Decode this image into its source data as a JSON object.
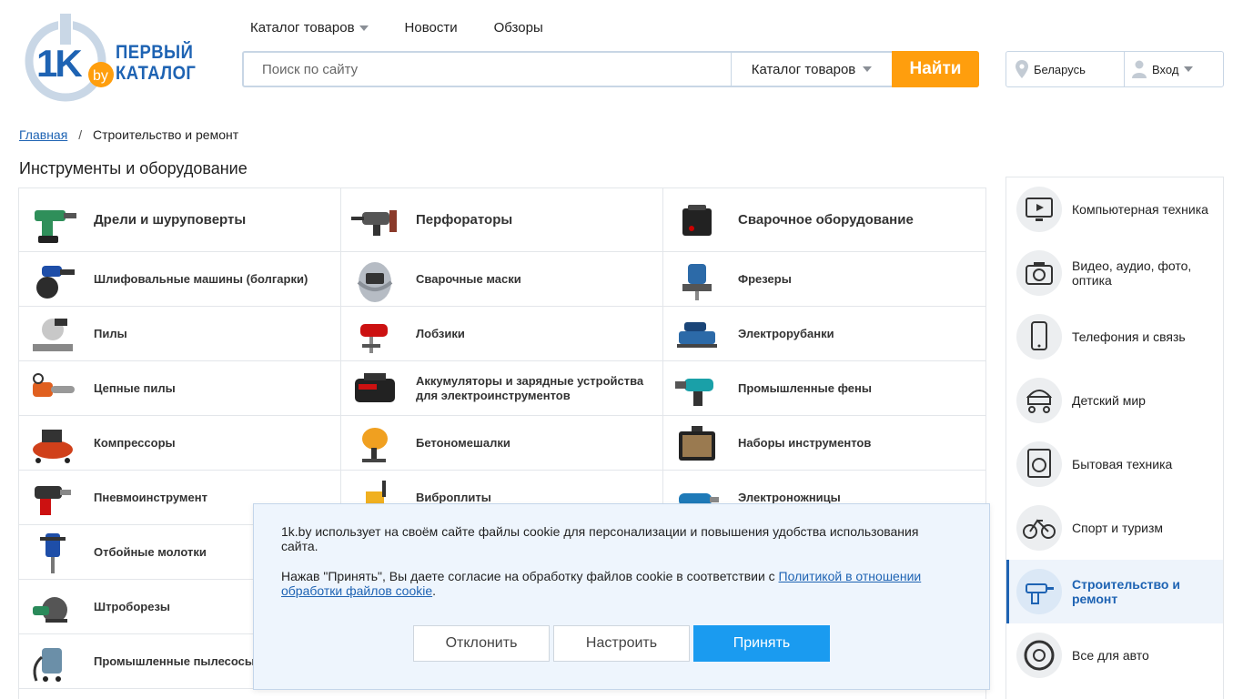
{
  "brand": {
    "logo_mark": "1K",
    "logo_domain": "by",
    "name_line1": "ПЕРВЫЙ",
    "name_line2": "КАТАЛОГ",
    "color": "#1e63b3",
    "accent": "#ff9e0d"
  },
  "topnav": {
    "catalog": "Каталог товаров",
    "news": "Новости",
    "reviews": "Обзоры"
  },
  "search": {
    "placeholder": "Поиск по сайту",
    "scope": "Каталог товаров",
    "button": "Найти"
  },
  "region": {
    "country": "Беларусь",
    "login": "Вход"
  },
  "breadcrumb": {
    "home": "Главная",
    "separator": "/",
    "current": "Строительство и ремонт"
  },
  "page_title": "Инструменты и оборудование",
  "categories": [
    {
      "label": "Дрели и шуруповерты",
      "icon": "drill-icon"
    },
    {
      "label": "Перфораторы",
      "icon": "hammer-drill-icon"
    },
    {
      "label": "Сварочное оборудование",
      "icon": "welder-icon"
    },
    {
      "label": "Шлифовальные машины (болгарки)",
      "icon": "grinder-icon"
    },
    {
      "label": "Сварочные маски",
      "icon": "welding-mask-icon"
    },
    {
      "label": "Фрезеры",
      "icon": "router-icon"
    },
    {
      "label": "Пилы",
      "icon": "miter-saw-icon"
    },
    {
      "label": "Лобзики",
      "icon": "jigsaw-icon"
    },
    {
      "label": "Электрорубанки",
      "icon": "planer-icon"
    },
    {
      "label": "Цепные пилы",
      "icon": "chainsaw-icon"
    },
    {
      "label": "Аккумуляторы и зарядные устройства для электроинструментов",
      "icon": "battery-icon"
    },
    {
      "label": "Промышленные фены",
      "icon": "heat-gun-icon"
    },
    {
      "label": "Компрессоры",
      "icon": "compressor-icon"
    },
    {
      "label": "Бетономешалки",
      "icon": "concrete-mixer-icon"
    },
    {
      "label": "Наборы инструментов",
      "icon": "toolbox-icon"
    },
    {
      "label": "Пневмоинструмент",
      "icon": "impact-wrench-icon"
    },
    {
      "label": "Виброплиты",
      "icon": "plate-compactor-icon"
    },
    {
      "label": "Электроножницы",
      "icon": "shears-icon"
    },
    {
      "label": "Отбойные молотки",
      "icon": "demolition-hammer-icon"
    },
    {
      "label": "",
      "icon": ""
    },
    {
      "label": "",
      "icon": ""
    },
    {
      "label": "Штроборезы",
      "icon": "wall-chaser-icon"
    },
    {
      "label": "",
      "icon": ""
    },
    {
      "label": "",
      "icon": ""
    },
    {
      "label": "Промышленные пылесосы",
      "icon": "vacuum-icon"
    },
    {
      "label": "",
      "icon": ""
    },
    {
      "label": "",
      "icon": ""
    }
  ],
  "sidebar": [
    {
      "label": "Компьютерная техника",
      "icon": "monitor-icon",
      "active": false
    },
    {
      "label": "Видео, аудио, фото, оптика",
      "icon": "camera-icon",
      "active": false
    },
    {
      "label": "Телефония и связь",
      "icon": "phone-icon",
      "active": false
    },
    {
      "label": "Детский мир",
      "icon": "stroller-icon",
      "active": false
    },
    {
      "label": "Бытовая техника",
      "icon": "washing-machine-icon",
      "active": false
    },
    {
      "label": "Спорт и туризм",
      "icon": "bicycle-icon",
      "active": false
    },
    {
      "label": "Строительство и ремонт",
      "icon": "drill-icon",
      "active": true
    },
    {
      "label": "Все для авто",
      "icon": "wheel-icon",
      "active": false
    }
  ],
  "cookie": {
    "text1": "1k.by использует на своём сайте файлы cookie для персонализации и повышения удобства использования сайта.",
    "text2_before": "Нажав \"Принять\", Вы даете согласие на обработку файлов cookie в соответствии с ",
    "text2_link": "Политикой в отношении обработки файлов cookie",
    "text2_after": ".",
    "decline": "Отклонить",
    "configure": "Настроить",
    "accept": "Принять"
  }
}
